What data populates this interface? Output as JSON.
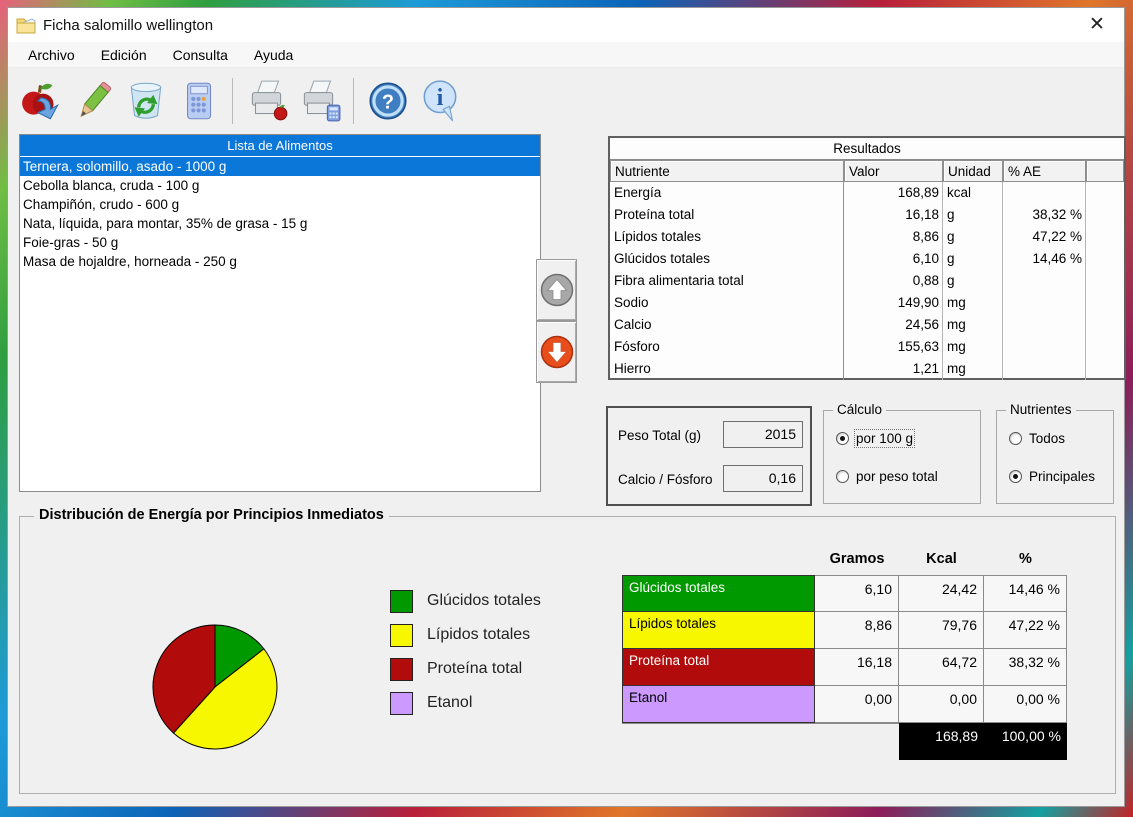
{
  "window": {
    "title": "Ficha salomillo wellington",
    "close_glyph": "✕"
  },
  "menu_bar": {
    "items": [
      "Archivo",
      "Edición",
      "Consulta",
      "Ayuda"
    ]
  },
  "toolbar": {
    "icons": [
      "apple-add-icon",
      "pencil-edit-icon",
      "trash-refresh-icon",
      "calculator-icon",
      "print-food-icon",
      "print-calculation-icon",
      "help-icon",
      "info-icon"
    ]
  },
  "food_list": {
    "header": "Lista de Alimentos",
    "selected_index": 0,
    "items": [
      "Ternera, solomillo, asado - 1000 g",
      "Cebolla blanca, cruda - 100 g",
      "Champiñón, crudo - 600 g",
      "Nata, líquida, para montar, 35% de grasa - 15 g",
      "Foie-gras - 50 g",
      "Masa de hojaldre, horneada - 250 g"
    ]
  },
  "results": {
    "title": "Resultados",
    "columns": [
      "Nutriente",
      "Valor",
      "Unidad",
      "% AE"
    ],
    "rows": [
      {
        "nutriente": "Energía",
        "valor": "168,89",
        "unidad": "kcal",
        "ae": ""
      },
      {
        "nutriente": "Proteína total",
        "valor": "16,18",
        "unidad": "g",
        "ae": "38,32 %"
      },
      {
        "nutriente": "Lípidos totales",
        "valor": "8,86",
        "unidad": "g",
        "ae": "47,22 %"
      },
      {
        "nutriente": "Glúcidos totales",
        "valor": "6,10",
        "unidad": "g",
        "ae": "14,46 %"
      },
      {
        "nutriente": "Fibra alimentaria total",
        "valor": "0,88",
        "unidad": "g",
        "ae": ""
      },
      {
        "nutriente": "Sodio",
        "valor": "149,90",
        "unidad": "mg",
        "ae": ""
      },
      {
        "nutriente": "Calcio",
        "valor": "24,56",
        "unidad": "mg",
        "ae": ""
      },
      {
        "nutriente": "Fósforo",
        "valor": "155,63",
        "unidad": "mg",
        "ae": ""
      },
      {
        "nutriente": "Hierro",
        "valor": "1,21",
        "unidad": "mg",
        "ae": ""
      }
    ]
  },
  "summary": {
    "peso_label": "Peso Total (g)",
    "peso_value": "2015",
    "calcio_fosforo_label": "Calcio / Fósforo",
    "calcio_fosforo_value": "0,16"
  },
  "calculo_group": {
    "title": "Cálculo",
    "options": [
      {
        "label": "por 100 g",
        "selected": true
      },
      {
        "label": "por peso total",
        "selected": false
      }
    ]
  },
  "nutrientes_group": {
    "title": "Nutrientes",
    "options": [
      {
        "label": "Todos",
        "selected": false
      },
      {
        "label": "Principales",
        "selected": true
      }
    ]
  },
  "energy_section": {
    "title": "Distribución de Energía por Principios Inmediatos",
    "legend": [
      {
        "label": "Glúcidos totales",
        "color": "#009900"
      },
      {
        "label": "Lípidos totales",
        "color": "#f7f700"
      },
      {
        "label": "Proteína total",
        "color": "#b20b0b"
      },
      {
        "label": "Etanol",
        "color": "#cc99ff"
      }
    ]
  },
  "chart_data": {
    "type": "pie",
    "labels": [
      "Glúcidos totales",
      "Lípidos totales",
      "Proteína total",
      "Etanol"
    ],
    "values": [
      14.46,
      47.22,
      38.32,
      0
    ],
    "colors": [
      "#009900",
      "#f7f700",
      "#b20b0b",
      "#cc99ff"
    ],
    "start_angle_deg": -90,
    "direction": "clockwise"
  },
  "energy_table": {
    "columns": [
      "Gramos",
      "Kcal",
      "%"
    ],
    "rows": [
      {
        "label": "Glúcidos totales",
        "gramos": "6,10",
        "kcal": "24,42",
        "pct": "14,46 %",
        "color": "#009900",
        "text_color": "#ffffff"
      },
      {
        "label": "Lípidos totales",
        "gramos": "8,86",
        "kcal": "79,76",
        "pct": "47,22 %",
        "color": "#f7f700",
        "text_color": "#000000"
      },
      {
        "label": "Proteína total",
        "gramos": "16,18",
        "kcal": "64,72",
        "pct": "38,32 %",
        "color": "#b20b0b",
        "text_color": "#ffffff"
      },
      {
        "label": "Etanol",
        "gramos": "0,00",
        "kcal": "0,00",
        "pct": "0,00 %",
        "color": "#cc99ff",
        "text_color": "#000000"
      }
    ],
    "total": {
      "kcal": "168,89",
      "pct": "100,00 %"
    }
  },
  "colors": {
    "selection_blue": "#0a77d9",
    "window_bg": "#f0f0f0"
  }
}
